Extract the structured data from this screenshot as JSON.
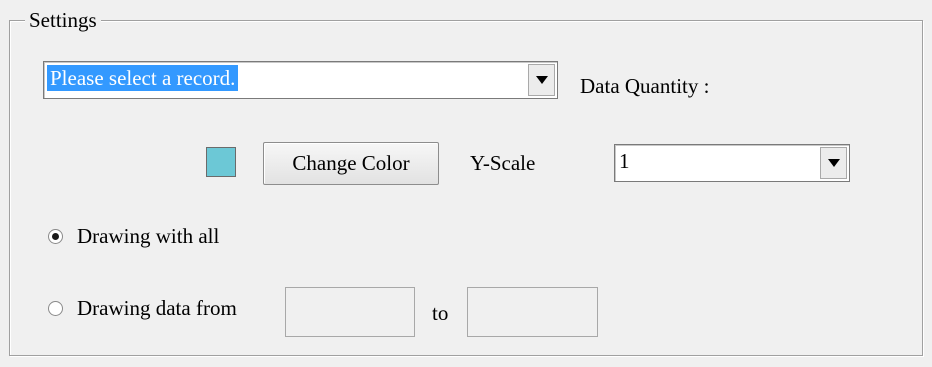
{
  "settings_group": {
    "title": "Settings"
  },
  "record_combo": {
    "value": "Please select a record."
  },
  "data_quantity": {
    "label": "Data Quantity :"
  },
  "color": {
    "swatch": "#6cc8d6",
    "button_label": "Change Color"
  },
  "y_scale": {
    "label": "Y-Scale",
    "value": "1"
  },
  "drawing_mode": {
    "all_label": "Drawing with all",
    "all_checked": true,
    "range_label": "Drawing data from",
    "range_checked": false,
    "to_label": "to",
    "from_value": "",
    "to_value": ""
  }
}
